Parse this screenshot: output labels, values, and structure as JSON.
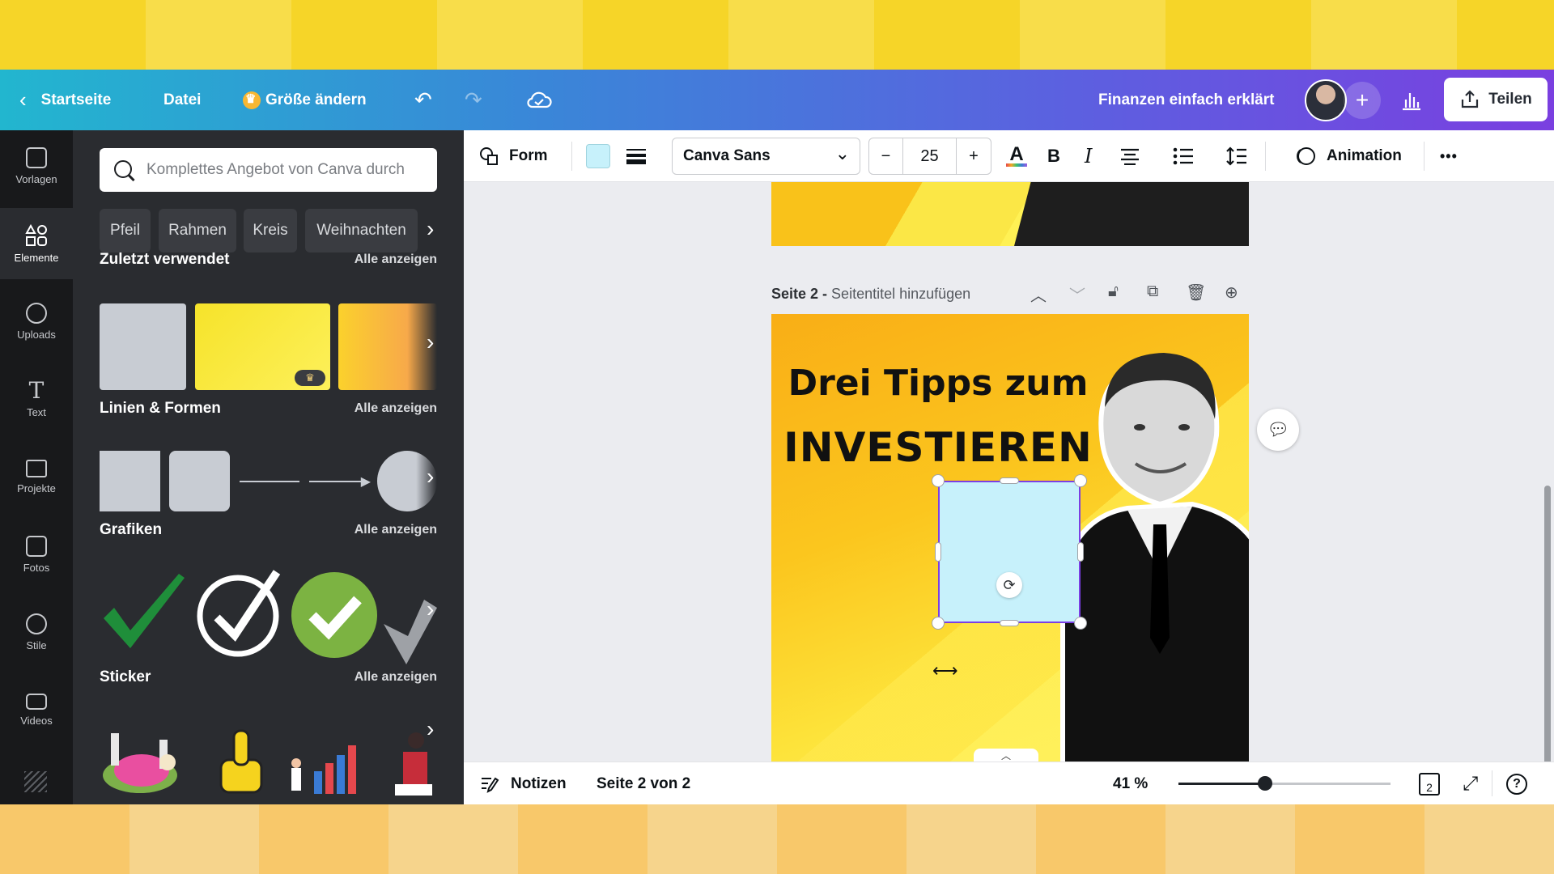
{
  "topbar": {
    "home": "Startseite",
    "file": "Datei",
    "resize": "Größe ändern",
    "project_title": "Finanzen einfach erklärt",
    "share": "Teilen",
    "icons": [
      "back-chevron-icon",
      "undo-icon",
      "redo-icon",
      "cloud-saved-icon",
      "plus-icon",
      "insights-chart-icon",
      "share-upload-icon"
    ]
  },
  "rail": {
    "items": [
      {
        "label": "Vorlagen",
        "icon": "templates-icon"
      },
      {
        "label": "Elemente",
        "icon": "elements-icon",
        "active": true
      },
      {
        "label": "Uploads",
        "icon": "upload-cloud-icon"
      },
      {
        "label": "Text",
        "icon": "text-icon"
      },
      {
        "label": "Projekte",
        "icon": "folder-icon"
      },
      {
        "label": "Fotos",
        "icon": "photo-icon"
      },
      {
        "label": "Stile",
        "icon": "palette-icon"
      },
      {
        "label": "Videos",
        "icon": "video-icon"
      }
    ]
  },
  "panel": {
    "search_placeholder": "Komplettes Angebot von Canva durch",
    "chips": [
      "Pfeil",
      "Rahmen",
      "Kreis",
      "Weihnachten"
    ],
    "see_all": "Alle anzeigen",
    "sections": {
      "recent": "Zuletzt verwendet",
      "lines_shapes": "Linien & Formen",
      "graphics": "Grafiken",
      "stickers": "Sticker"
    }
  },
  "toolbar": {
    "shape": "Form",
    "font": "Canva Sans",
    "size_minus": "−",
    "font_size": "25",
    "size_plus": "+",
    "bold": "B",
    "italic": "I",
    "animation": "Animation",
    "more": "•••",
    "shape_color": "#c7f1fb"
  },
  "canvas": {
    "page_label": "Seite 2 -",
    "page_title_placeholder": "Seitentitel hinzufügen",
    "headline_line1": "Drei Tipps zum",
    "headline_line2": "INVESTIEREN"
  },
  "bottombar": {
    "notes": "Notizen",
    "page_info": "Seite 2 von 2",
    "zoom": "41 %",
    "zoom_level": 0.41,
    "page_count": "2",
    "help": "?"
  }
}
